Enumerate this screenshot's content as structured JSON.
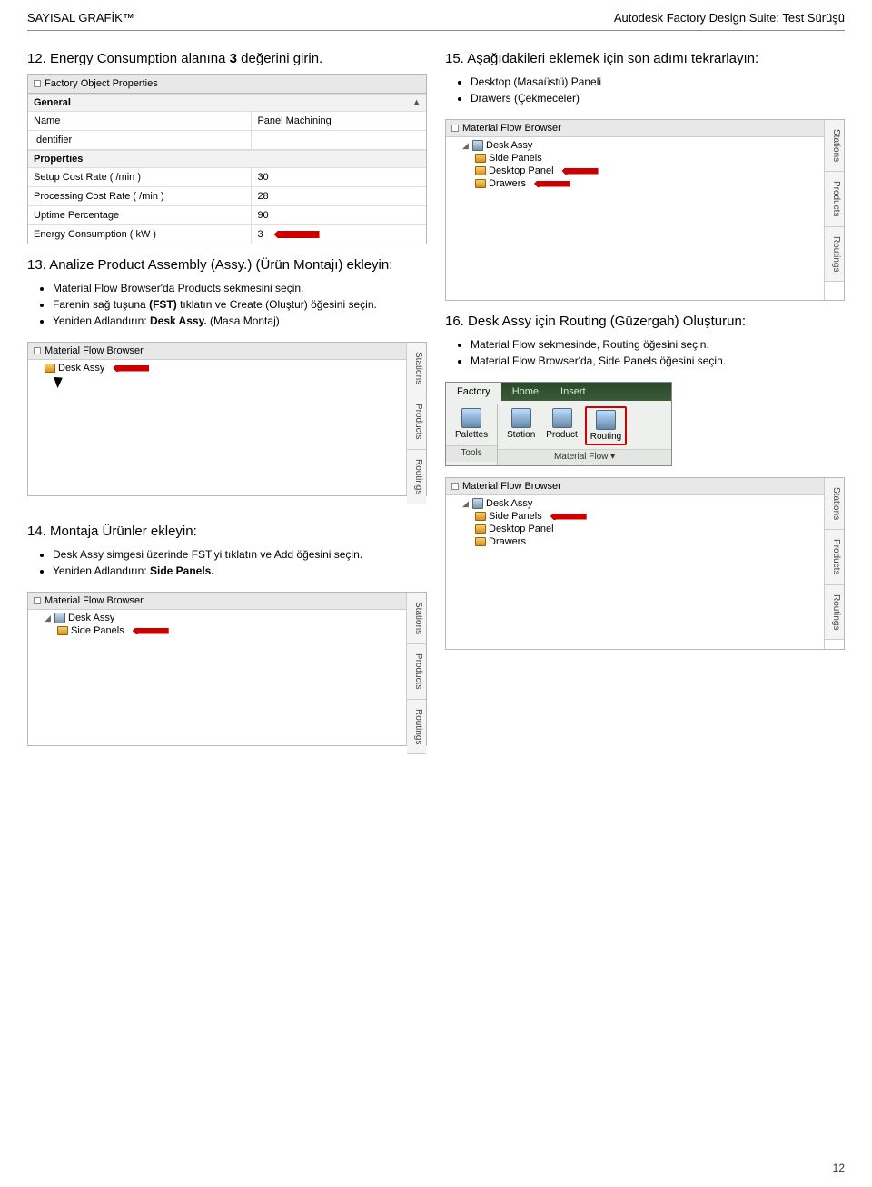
{
  "header": {
    "left": "SAYISAL GRAFİK™",
    "right": "Autodesk Factory Design Suite: Test Sürüşü"
  },
  "step12": {
    "title_pre": "12. Energy Consumption alanına ",
    "title_bold": "3",
    "title_post": " değerini girin."
  },
  "fop": {
    "title": "Factory Object Properties",
    "section_general": "General",
    "section_props": "Properties",
    "rows_general": [
      {
        "k": "Name",
        "v": "Panel Machining"
      },
      {
        "k": "Identifier",
        "v": ""
      }
    ],
    "rows_props": [
      {
        "k": "Setup Cost Rate ( /min )",
        "v": "30"
      },
      {
        "k": "Processing Cost Rate ( /min )",
        "v": "28"
      },
      {
        "k": "Uptime Percentage",
        "v": "90"
      },
      {
        "k": "Energy Consumption ( kW )",
        "v": "3"
      }
    ]
  },
  "step13": {
    "title": "13. Analize Product Assembly (Assy.) (Ürün Montajı) ekleyin:",
    "bullets": [
      "Material Flow Browser'da Products sekmesini seçin.",
      "Farenin sağ tuşuna (FST) tıklatın ve Create (Oluştur) öğesini seçin.",
      "Yeniden Adlandırın: Desk Assy. (Masa Montaj)"
    ]
  },
  "mfb1": {
    "title": "Material Flow Browser",
    "items": [
      "Desk Assy"
    ],
    "tabs": [
      "Stations",
      "Products",
      "Routings"
    ]
  },
  "step15": {
    "title": "15. Aşağıdakileri eklemek için son adımı tekrarlayın:",
    "bullets": [
      "Desktop (Masaüstü) Paneli",
      "Drawers (Çekmeceler)"
    ]
  },
  "mfb2": {
    "title": "Material Flow Browser",
    "root": "Desk Assy",
    "children": [
      "Side Panels",
      "Desktop Panel",
      "Drawers"
    ],
    "tabs": [
      "Stations",
      "Products",
      "Routings"
    ]
  },
  "step16": {
    "title": "16. Desk Assy için Routing (Güzergah) Oluşturun:",
    "bullets": [
      "Material Flow sekmesinde, Routing  öğesini seçin.",
      "Material Flow Browser'da, Side Panels öğesini seçin."
    ]
  },
  "ribbon": {
    "tabs": [
      "Factory",
      "Home",
      "Insert"
    ],
    "group_tools": {
      "label": "Tools",
      "btn": "Palettes"
    },
    "group_mf": {
      "label": "Material Flow ▾",
      "btns": [
        "Station",
        "Product",
        "Routing"
      ]
    }
  },
  "mfb3": {
    "title": "Material Flow Browser",
    "root": "Desk Assy",
    "children": [
      "Side Panels",
      "Desktop Panel",
      "Drawers"
    ],
    "tabs": [
      "Stations",
      "Products",
      "Routings"
    ]
  },
  "step14": {
    "title": "14. Montaja Ürünler ekleyin:",
    "bullets": [
      "Desk Assy simgesi üzerinde FST'yi tıklatın ve Add öğesini seçin.",
      "Yeniden Adlandırın: Side Panels."
    ]
  },
  "mfb4": {
    "title": "Material Flow Browser",
    "root": "Desk Assy",
    "children": [
      "Side Panels"
    ],
    "tabs": [
      "Stations",
      "Products",
      "Routings"
    ]
  },
  "page_number": "12"
}
